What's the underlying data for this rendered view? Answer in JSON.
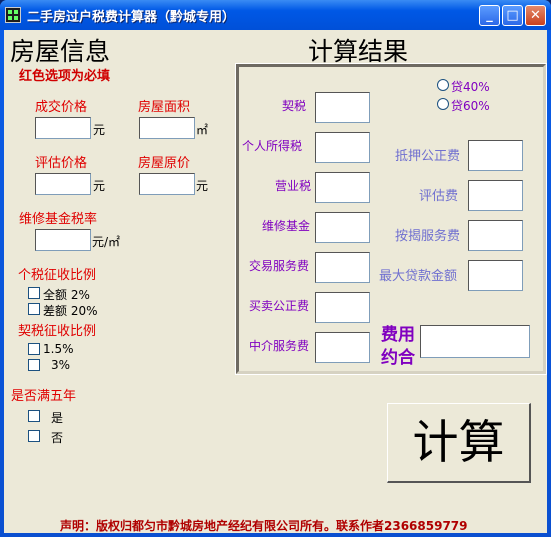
{
  "window": {
    "title": "二手房过户税费计算器（黔城专用）"
  },
  "left": {
    "heading": "房屋信息",
    "required_note": "红色选项为必填",
    "deal_price": {
      "label": "成交价格",
      "unit": "元"
    },
    "area": {
      "label": "房屋面积",
      "unit": "㎡"
    },
    "eval_price": {
      "label": "评估价格",
      "unit": "元"
    },
    "orig_price": {
      "label": "房屋原价",
      "unit": "元"
    },
    "maint_rate": {
      "label": "维修基金税率",
      "unit": "元/㎡"
    },
    "income_tax_ratio": {
      "label": "个税征收比例",
      "options": [
        "全额  2%",
        "差额 20%"
      ]
    },
    "deed_tax_ratio": {
      "label": "契税征收比例",
      "options": [
        "1.5%",
        "3%"
      ]
    },
    "five_years": {
      "label": "是否满五年",
      "options": [
        "是",
        "否"
      ]
    }
  },
  "right": {
    "heading": "计算结果",
    "loan_options": [
      "贷40%",
      "贷60%"
    ],
    "left_fields": [
      "契税",
      "个人所得税",
      "营业税",
      "维修基金",
      "交易服务费",
      "买卖公正费",
      "中介服务费"
    ],
    "right_fields": [
      "抵押公正费",
      "评估费",
      "按揭服务费",
      "最大贷款金额"
    ],
    "total_label_1": "费用",
    "total_label_2": "约合"
  },
  "calc_button": "计算",
  "footer": "声明：版权归都匀市黔城房地产经纪有限公司所有。联系作者2366859779"
}
